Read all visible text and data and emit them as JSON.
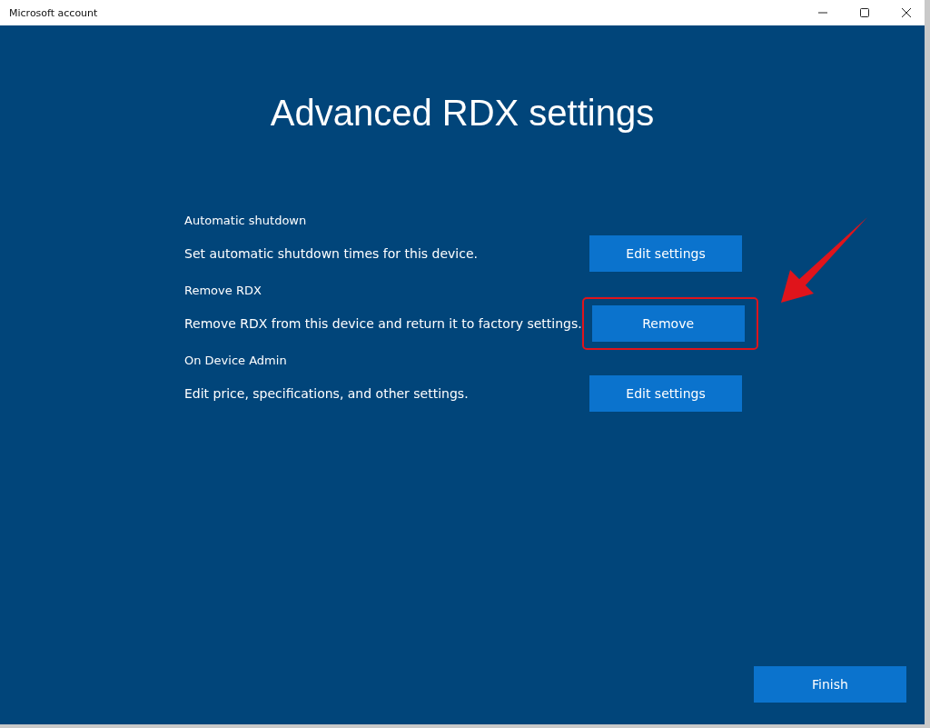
{
  "window": {
    "title": "Microsoft account"
  },
  "heading": "Advanced RDX settings",
  "sections": [
    {
      "label": "Automatic shutdown",
      "description": "Set automatic shutdown times for this device.",
      "button": "Edit settings",
      "highlighted": false
    },
    {
      "label": "Remove RDX",
      "description": "Remove RDX from this device and return it to factory settings.",
      "button": "Remove",
      "highlighted": true
    },
    {
      "label": "On Device Admin",
      "description": "Edit price, specifications, and other settings.",
      "button": "Edit settings",
      "highlighted": false
    }
  ],
  "finish_button": "Finish"
}
